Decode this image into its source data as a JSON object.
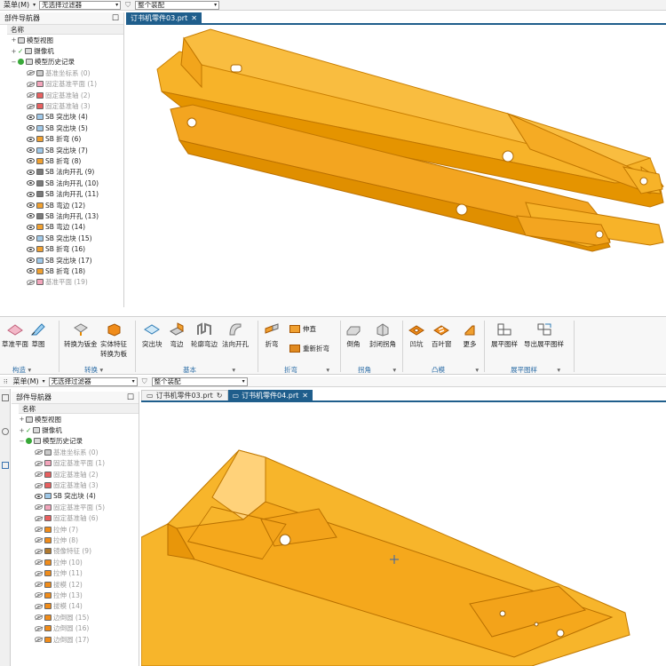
{
  "colors": {
    "accent_tab": "#1f5e8c",
    "part_orange": "#f5a81c",
    "ribbon_group": "#2b6ca6"
  },
  "top": {
    "menu_label": "菜单(M)",
    "filter_value": "无选择过滤器",
    "assembly_value": "整个装配",
    "navigator_title": "部件导航器",
    "col_header": "名称",
    "tab_active": "订书机零件03.prt",
    "tree": [
      {
        "t": "模型视图",
        "dim": false
      },
      {
        "t": "摄像机",
        "dim": false
      },
      {
        "t": "模型历史记录",
        "dim": false
      },
      {
        "t": "基准坐标系 (0)",
        "dim": true
      },
      {
        "t": "固定基准平面 (1)",
        "dim": true
      },
      {
        "t": "固定基准轴 (2)",
        "dim": true
      },
      {
        "t": "固定基准轴 (3)",
        "dim": true
      },
      {
        "t": "SB 突出块 (4)",
        "dim": false
      },
      {
        "t": "SB 突出块 (5)",
        "dim": false
      },
      {
        "t": "SB 折弯 (6)",
        "dim": false
      },
      {
        "t": "SB 突出块 (7)",
        "dim": false
      },
      {
        "t": "SB 折弯 (8)",
        "dim": false
      },
      {
        "t": "SB 法向开孔 (9)",
        "dim": false
      },
      {
        "t": "SB 法向开孔 (10)",
        "dim": false
      },
      {
        "t": "SB 法向开孔 (11)",
        "dim": false
      },
      {
        "t": "SB 弯边 (12)",
        "dim": false
      },
      {
        "t": "SB 法向开孔 (13)",
        "dim": false
      },
      {
        "t": "SB 弯边 (14)",
        "dim": false
      },
      {
        "t": "SB 突出块 (15)",
        "dim": false
      },
      {
        "t": "SB 折弯 (16)",
        "dim": false
      },
      {
        "t": "SB 突出块 (17)",
        "dim": false
      },
      {
        "t": "SB 折弯 (18)",
        "dim": false
      },
      {
        "t": "基准平面 (19)",
        "dim": true
      }
    ]
  },
  "ribbon": {
    "btn_sketch_plane": "草准平面",
    "btn_sketch": "草图",
    "btn_convert": "转换为钣金",
    "btn_solid_feature": "实体特征",
    "btn_to_sheet": "转换为板",
    "btn_tab": "突出块",
    "btn_flange": "弯边",
    "btn_contour_flange": "轮廓弯边",
    "btn_normal_cutout": "法向开孔",
    "btn_bend": "折弯",
    "btn_unbend": "伸直",
    "btn_rebend": "重新折弯",
    "btn_chamfer": "倒角",
    "btn_closed_corner": "封闭拐角",
    "btn_dimple": "凹坑",
    "btn_louver": "百叶窗",
    "btn_more": "更多",
    "btn_flat_pattern": "展平图样",
    "btn_export_flat": "导出展平图样",
    "grp_construct": "构造",
    "grp_convert": "转换",
    "grp_basic": "基本",
    "grp_bend": "折弯",
    "grp_corner": "拐角",
    "grp_form": "凸模",
    "grp_flat": "展平图样"
  },
  "bottom": {
    "menu_label": "菜单(M)",
    "filter_value": "无选择过滤器",
    "assembly_value": "整个装配",
    "navigator_title": "部件导航器",
    "col_header": "名称",
    "tab_inactive": "订书机零件03.prt",
    "tab_active": "订书机零件04.prt",
    "tree": [
      {
        "t": "模型视图",
        "dim": false
      },
      {
        "t": "摄像机",
        "dim": false
      },
      {
        "t": "模型历史记录",
        "dim": false
      },
      {
        "t": "基准坐标系 (0)",
        "dim": true
      },
      {
        "t": "固定基准平面 (1)",
        "dim": true
      },
      {
        "t": "固定基准轴 (2)",
        "dim": true
      },
      {
        "t": "固定基准轴 (3)",
        "dim": true
      },
      {
        "t": "SB 突出块 (4)",
        "dim": false
      },
      {
        "t": "固定基准平面 (5)",
        "dim": true
      },
      {
        "t": "固定基准轴 (6)",
        "dim": true
      },
      {
        "t": "拉伸 (7)",
        "dim": true
      },
      {
        "t": "拉伸 (8)",
        "dim": true
      },
      {
        "t": "镜像特征 (9)",
        "dim": true
      },
      {
        "t": "拉伸 (10)",
        "dim": true
      },
      {
        "t": "拉伸 (11)",
        "dim": true
      },
      {
        "t": "拔模 (12)",
        "dim": true
      },
      {
        "t": "拉伸 (13)",
        "dim": true
      },
      {
        "t": "拔模 (14)",
        "dim": true
      },
      {
        "t": "边倒圆 (15)",
        "dim": true
      },
      {
        "t": "边倒圆 (16)",
        "dim": true
      },
      {
        "t": "边倒圆 (17)",
        "dim": true
      }
    ]
  }
}
